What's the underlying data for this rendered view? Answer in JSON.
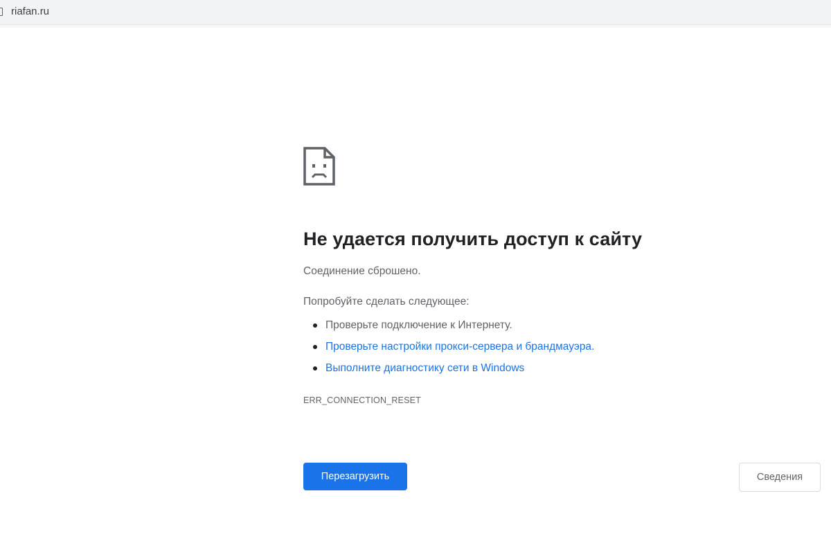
{
  "address_bar": {
    "url": "riafan.ru",
    "page_icon": "page-icon"
  },
  "error_page": {
    "icon": "sad-page-icon",
    "heading": "Не удается получить доступ к сайту",
    "summary": "Соединение сброшено.",
    "suggestions_title": "Попробуйте сделать следующее:",
    "suggestions": [
      {
        "text": "Проверьте подключение к Интернету.",
        "is_link": false
      },
      {
        "text": "Проверьте настройки прокси-сервера и брандмауэра.",
        "is_link": true
      },
      {
        "text": "Выполните диагностику сети в Windows",
        "is_link": true
      }
    ],
    "error_code": "ERR_CONNECTION_RESET",
    "reload_label": "Перезагрузить",
    "details_label": "Сведения"
  },
  "colors": {
    "primary_button": "#1a73e8",
    "link": "#1a73e8",
    "heading": "#202124",
    "body_text": "#5f6368"
  }
}
